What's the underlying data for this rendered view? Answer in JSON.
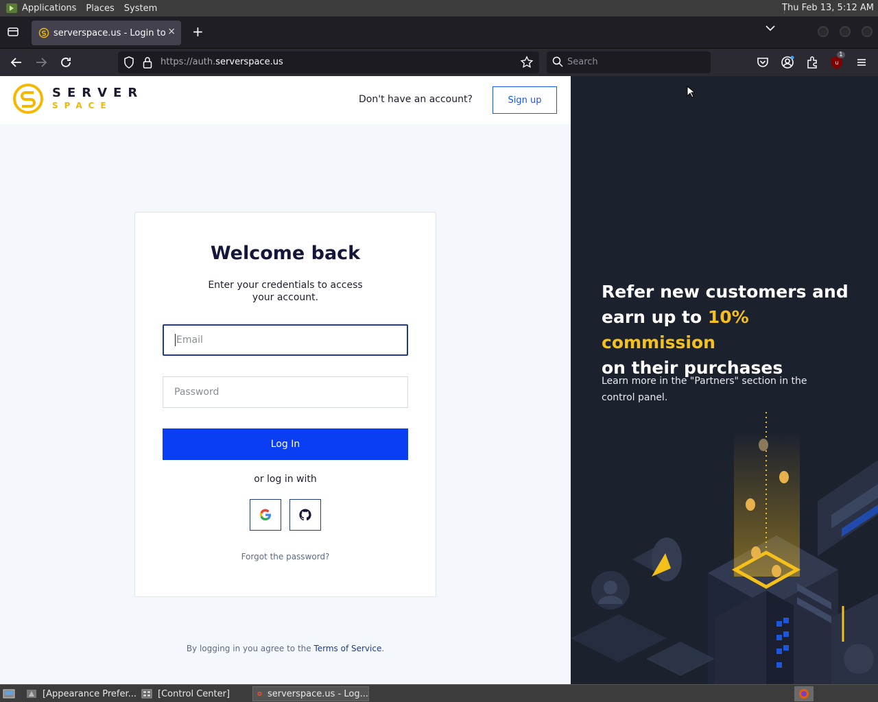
{
  "system_panel": {
    "menus": [
      "Applications",
      "Places",
      "System"
    ],
    "clock": "Thu Feb 13,  5:12 AM"
  },
  "browser": {
    "tab": {
      "title": "serverspace.us - Login to co",
      "close_glyph": "×"
    },
    "new_tab_glyph": "+",
    "url_dim": "https://auth.",
    "url_main": "serverspace.us",
    "search_placeholder": "Search",
    "extension_badge": "1"
  },
  "page": {
    "logo": {
      "word1": "SERVER",
      "word2": "SPACE"
    },
    "header": {
      "no_account_text": "Don't have an account?",
      "signup_label": "Sign up"
    },
    "card": {
      "heading": "Welcome back",
      "subtitle": "Enter your credentials to access your account.",
      "email_placeholder": "Email",
      "password_placeholder": "Password",
      "login_label": "Log In",
      "or_text": "or log in with",
      "forgot_label": "Forgot the password?"
    },
    "tos": {
      "prefix": "By logging in you agree to the ",
      "link": "Terms of Service",
      "suffix": "."
    },
    "promo": {
      "line1": "Refer new customers and",
      "line2_pre": "earn up to ",
      "line2_highlight": "10% commission",
      "line3": "on their purchases",
      "sub": "Learn more in the \"Partners\" section in the control panel."
    }
  },
  "taskbar": {
    "items": [
      "[Appearance Prefer...",
      "[Control Center]",
      "serverspace.us - Log..."
    ]
  },
  "colors": {
    "brand_yellow": "#f5c01a",
    "primary_blue": "#0a3ef5",
    "dark_panel": "#1c212e"
  }
}
